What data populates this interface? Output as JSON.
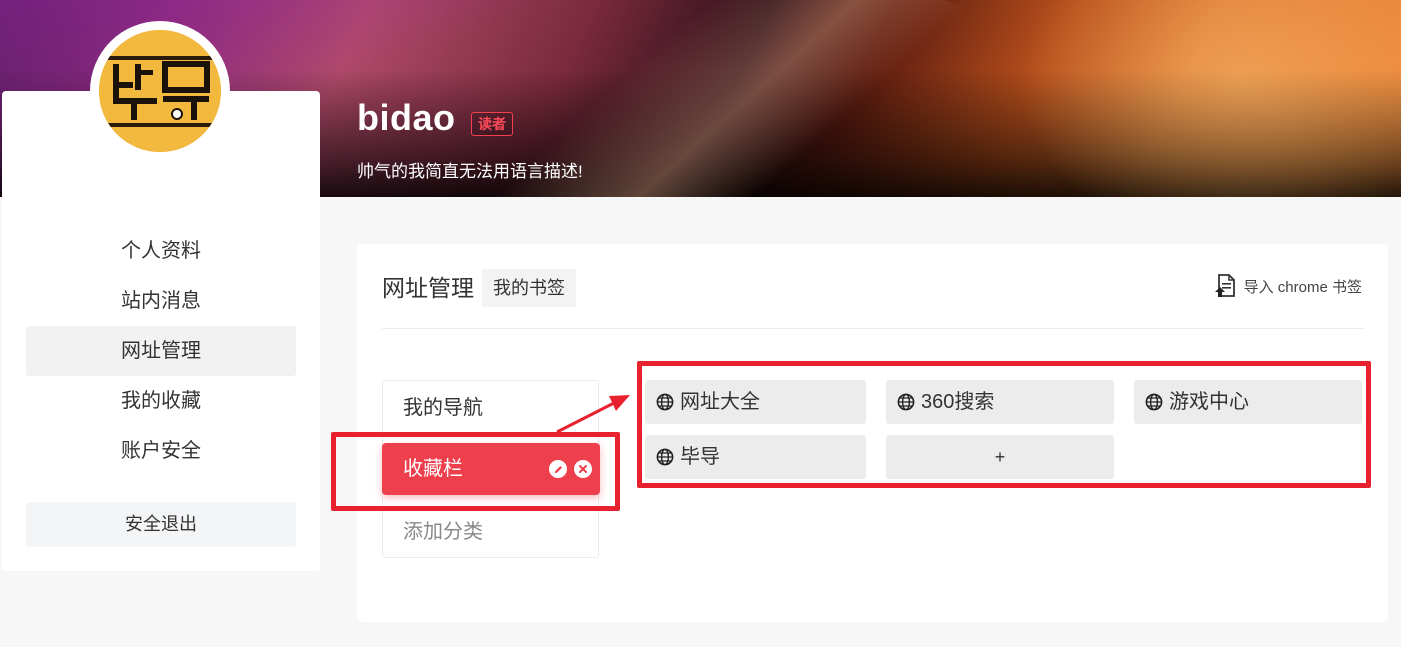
{
  "profile": {
    "username": "bidao",
    "role_badge": "读者",
    "signature": "帅气的我简直无法用语言描述!",
    "avatar_text": "毕导"
  },
  "sidebar": {
    "items": [
      {
        "label": "个人资料",
        "active": false
      },
      {
        "label": "站内消息",
        "active": false
      },
      {
        "label": "网址管理",
        "active": true
      },
      {
        "label": "我的收藏",
        "active": false
      },
      {
        "label": "账户安全",
        "active": false
      }
    ],
    "logout_label": "安全退出"
  },
  "panel": {
    "title": "网址管理",
    "tab_label": "我的书签",
    "import_label": "导入 chrome 书签",
    "categories": [
      {
        "label": "我的导航"
      },
      {
        "label": "收藏栏",
        "active": true
      },
      {
        "label": "添加分类"
      }
    ],
    "sites": [
      {
        "label": "网址大全"
      },
      {
        "label": "360搜索"
      },
      {
        "label": "游戏中心"
      },
      {
        "label": "毕导"
      }
    ],
    "add_label": "+"
  },
  "colors": {
    "accent": "#ee3f4d",
    "annotation": "#e8212f",
    "badge": "#f23f4f"
  },
  "icons": {
    "site": "globe-icon",
    "import": "bookmark-import-icon",
    "edit": "pencil-icon",
    "delete": "close-icon"
  }
}
